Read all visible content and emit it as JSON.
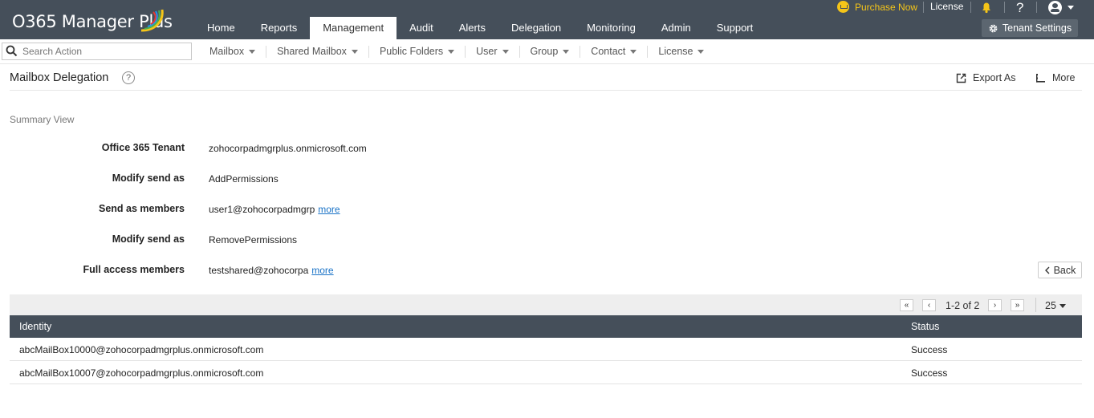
{
  "app": {
    "title": "O365 Manager Plus"
  },
  "topbar": {
    "purchase": "Purchase Now",
    "license": "License",
    "help": "?",
    "tenant_settings": "Tenant Settings",
    "brand_color": "#454f5a",
    "accent_color": "#f5c518"
  },
  "nav": [
    "Home",
    "Reports",
    "Management",
    "Audit",
    "Alerts",
    "Delegation",
    "Monitoring",
    "Admin",
    "Support"
  ],
  "nav_active": "Management",
  "subnav": {
    "search_placeholder": "Search Action",
    "items": [
      "Mailbox",
      "Shared Mailbox",
      "Public Folders",
      "User",
      "Group",
      "Contact",
      "License"
    ]
  },
  "page": {
    "title": "Mailbox Delegation",
    "help": "?",
    "export": "Export As",
    "more": "More",
    "back": "Back"
  },
  "summary": {
    "label": "Summary View",
    "rows": [
      {
        "label": "Office 365 Tenant",
        "value": "zohocorpadmgrplus.onmicrosoft.com",
        "more": ""
      },
      {
        "label": "Modify send as",
        "value": "AddPermissions",
        "more": ""
      },
      {
        "label": "Send as members",
        "value": "user1@zohocorpadmgrp",
        "more": "more"
      },
      {
        "label": "Modify send as",
        "value": "RemovePermissions",
        "more": ""
      },
      {
        "label": "Full access members",
        "value": "testshared@zohocorpa",
        "more": "more"
      }
    ]
  },
  "pager": {
    "first": "«",
    "prev": "‹",
    "range": "1-2 of 2",
    "next": "›",
    "last": "»",
    "page_size": "25"
  },
  "table": {
    "columns": [
      "Identity",
      "Status"
    ],
    "rows": [
      {
        "identity": "abcMailBox10000@zohocorpadmgrplus.onmicrosoft.com",
        "status": "Success"
      },
      {
        "identity": "abcMailBox10007@zohocorpadmgrplus.onmicrosoft.com",
        "status": "Success"
      }
    ]
  }
}
